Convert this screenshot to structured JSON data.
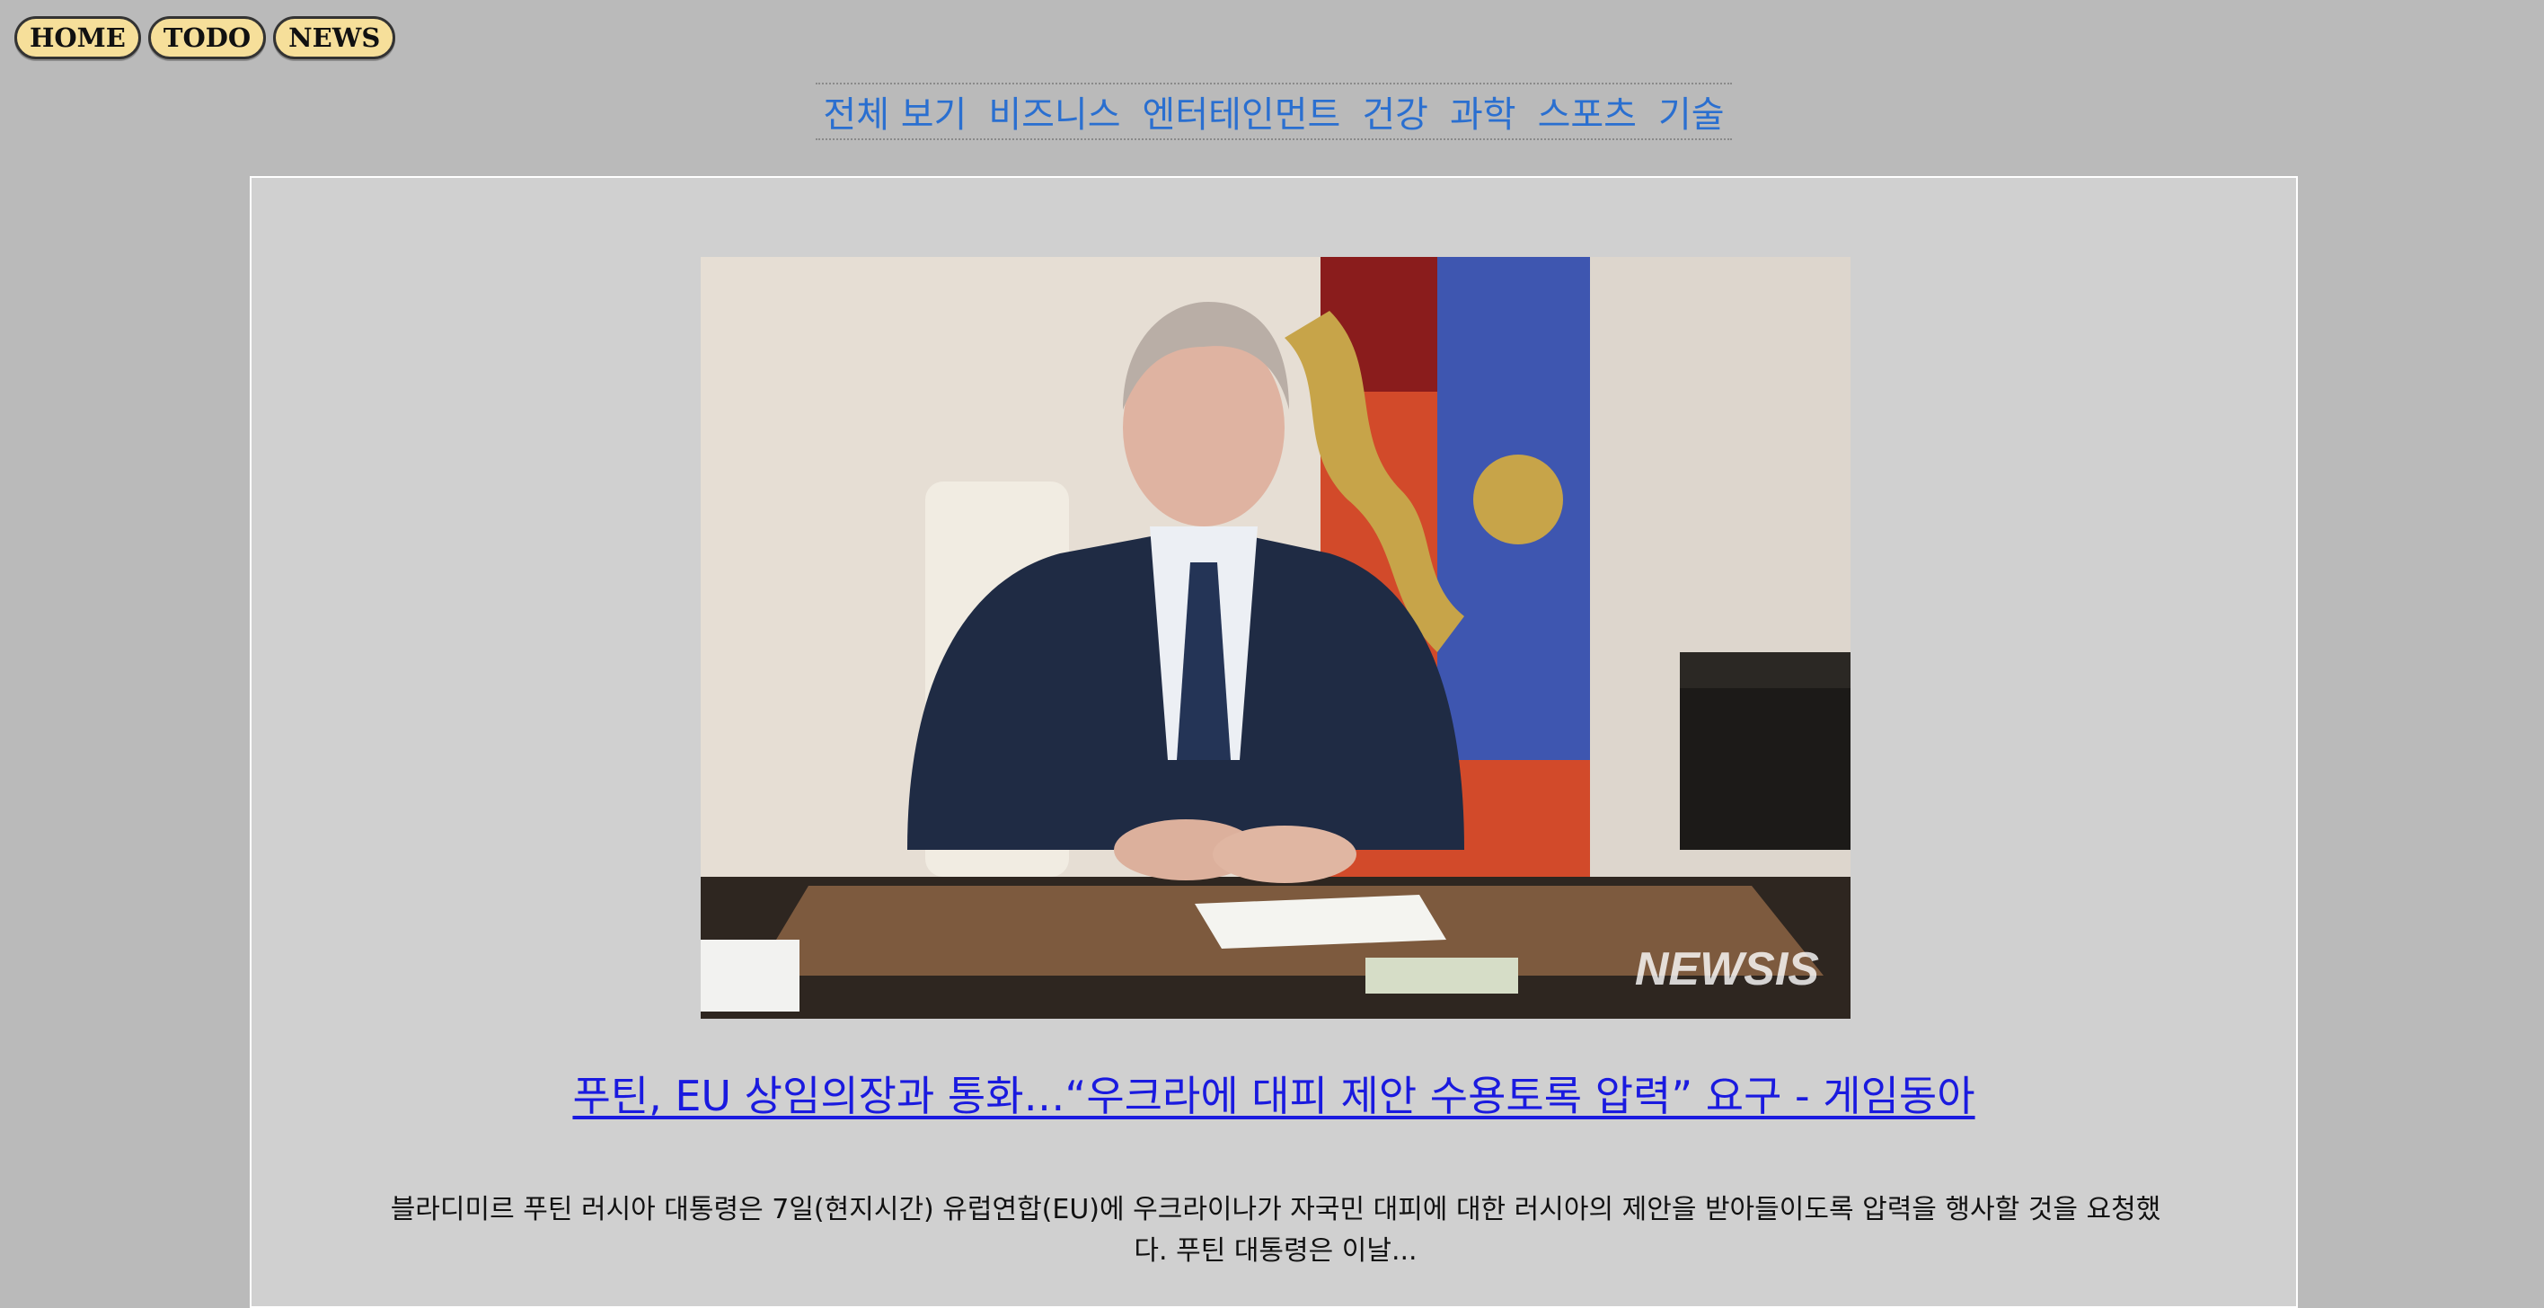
{
  "top_nav": {
    "items": [
      {
        "label": "HOME"
      },
      {
        "label": "TODO"
      },
      {
        "label": "NEWS"
      }
    ]
  },
  "category_nav": {
    "items": [
      {
        "label": "전체 보기"
      },
      {
        "label": "비즈니스"
      },
      {
        "label": "엔터테인먼트"
      },
      {
        "label": "건강"
      },
      {
        "label": "과학"
      },
      {
        "label": "스포츠"
      },
      {
        "label": "기술"
      }
    ]
  },
  "article": {
    "image": {
      "watermark": "NEWSIS",
      "icon": "news-photo"
    },
    "headline": "푸틴, EU 상임의장과 통화…“우크라에 대피 제안 수용토록 압력” 요구 - 게임동아",
    "summary": "블라디미르 푸틴 러시아 대통령은 7일(현지시간) 유럽연합(EU)에 우크라이나가 자국민 대피에 대한 러시아의 제안을 받아들이도록 압력을 행사할 것을 요청했다. 푸틴 대통령은 이날..."
  },
  "colors": {
    "background": "#bababa",
    "card": "#d0d0d0",
    "pill": "#f6df9a",
    "category_link": "#2a6fd0",
    "headline_link": "#1a1adf"
  }
}
